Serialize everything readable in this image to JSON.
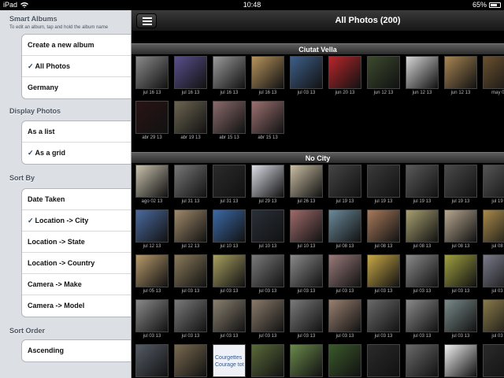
{
  "status": {
    "carrier": "iPad",
    "time": "10:48",
    "battery": "65%"
  },
  "sidebar": {
    "smart_albums": {
      "title": "Smart Albums",
      "subtitle": "To edit an album, tap and hold the album name",
      "items": [
        {
          "label": "Create a new album",
          "checked": false
        },
        {
          "label": "All Photos",
          "checked": true
        },
        {
          "label": "Germany",
          "checked": false
        }
      ]
    },
    "display": {
      "title": "Display Photos",
      "items": [
        {
          "label": "As a list",
          "checked": false
        },
        {
          "label": "As a grid",
          "checked": true
        }
      ]
    },
    "sort_by": {
      "title": "Sort By",
      "items": [
        {
          "label": "Date Taken",
          "checked": false
        },
        {
          "label": "Location -> City",
          "checked": true
        },
        {
          "label": "Location -> State",
          "checked": false
        },
        {
          "label": "Location -> Country",
          "checked": false
        },
        {
          "label": "Camera -> Make",
          "checked": false
        },
        {
          "label": "Camera -> Model",
          "checked": false
        }
      ]
    },
    "sort_order": {
      "title": "Sort Order",
      "items": [
        {
          "label": "Ascending",
          "checked": false
        }
      ]
    }
  },
  "main": {
    "title": "All Photos (200)",
    "sections": [
      {
        "name": "Ciutat Vella",
        "photos": [
          {
            "date": "jul 16 13",
            "color": "#8a8a8a"
          },
          {
            "date": "jul 16 13",
            "color": "#5a4f8c"
          },
          {
            "date": "jul 16 13",
            "color": "#9a9a9a"
          },
          {
            "date": "jul 16 13",
            "color": "#b8945c"
          },
          {
            "date": "jul 03 13",
            "color": "#3d5f8a"
          },
          {
            "date": "jun 20 13",
            "color": "#b8262b"
          },
          {
            "date": "jun 12 13",
            "color": "#3c4a2e"
          },
          {
            "date": "jun 12 13",
            "color": "#d6d6d6"
          },
          {
            "date": "jun 12 13",
            "color": "#a88552"
          },
          {
            "date": "may 07",
            "color": "#6a5030"
          },
          {
            "date": "abr 29 13",
            "color": "#2a1414"
          },
          {
            "date": "abr 19 13",
            "color": "#6b6450"
          },
          {
            "date": "abr 15 13",
            "color": "#8b6a6a"
          },
          {
            "date": "abr 15 13",
            "color": "#9c7070"
          }
        ]
      },
      {
        "name": "No City",
        "photos": [
          {
            "date": "ago 02 13",
            "color": "#c9c2ad"
          },
          {
            "date": "jul 31 13",
            "color": "#777777"
          },
          {
            "date": "jul 31 13",
            "color": "#2b2b2b"
          },
          {
            "date": "jul 29 13",
            "color": "#dcdde6"
          },
          {
            "date": "jul 26 13",
            "color": "#cbbfa3"
          },
          {
            "date": "jul 19 13",
            "color": "#444444"
          },
          {
            "date": "jul 19 13",
            "color": "#3a3a3a"
          },
          {
            "date": "jul 19 13",
            "color": "#5a5a5a"
          },
          {
            "date": "jul 19 13",
            "color": "#4a4a4a"
          },
          {
            "date": "jul 19 1",
            "color": "#555555"
          },
          {
            "date": "jul 12 13",
            "color": "#4a6aa0"
          },
          {
            "date": "jul 12 13",
            "color": "#a08a6a"
          },
          {
            "date": "jul 10 13",
            "color": "#3a6aa8"
          },
          {
            "date": "jul 10 13",
            "color": "#2a2f38"
          },
          {
            "date": "jul 10 13",
            "color": "#a06a6a"
          },
          {
            "date": "jul 08 13",
            "color": "#6a8a9a"
          },
          {
            "date": "jul 08 13",
            "color": "#a87a5a"
          },
          {
            "date": "jul 08 13",
            "color": "#a8a070"
          },
          {
            "date": "jul 08 13",
            "color": "#b8a890"
          },
          {
            "date": "jul 08 1",
            "color": "#a88a4a"
          },
          {
            "date": "jul 05 13",
            "color": "#b89a6a"
          },
          {
            "date": "jul 03 13",
            "color": "#8a7a5a"
          },
          {
            "date": "jul 03 13",
            "color": "#a8a060"
          },
          {
            "date": "jul 03 13",
            "color": "#7a7a7a"
          },
          {
            "date": "jul 03 13",
            "color": "#8a8a8a"
          },
          {
            "date": "jul 03 13",
            "color": "#9a7a7a"
          },
          {
            "date": "jul 03 13",
            "color": "#c9a845"
          },
          {
            "date": "jul 03 13",
            "color": "#8a8a8a"
          },
          {
            "date": "jul 03 13",
            "color": "#a0a040"
          },
          {
            "date": "jul 03 1",
            "color": "#7a7a8a"
          },
          {
            "date": "jul 03 13",
            "color": "#8a8a8a"
          },
          {
            "date": "jul 03 13",
            "color": "#7a7a7a"
          },
          {
            "date": "jul 03 13",
            "color": "#8a8070"
          },
          {
            "date": "jul 03 13",
            "color": "#8a7a6a"
          },
          {
            "date": "jul 03 13",
            "color": "#7a7a7a"
          },
          {
            "date": "jul 03 13",
            "color": "#9a8070"
          },
          {
            "date": "jul 03 13",
            "color": "#6a6a6a"
          },
          {
            "date": "jul 03 13",
            "color": "#8a8a8a"
          },
          {
            "date": "jul 03 13",
            "color": "#7a8a8a"
          },
          {
            "date": "jul 03 1",
            "color": "#8a7a4a"
          },
          {
            "date": "",
            "color": "#555c66"
          },
          {
            "date": "",
            "color": "#7a6a50"
          },
          {
            "date": "",
            "color": "#e8ecf4"
          },
          {
            "date": "",
            "color": "#5a6a3a"
          },
          {
            "date": "",
            "color": "#6a8a4a"
          },
          {
            "date": "",
            "color": "#3a5a2a"
          },
          {
            "date": "",
            "color": "#2a2a2a"
          },
          {
            "date": "",
            "color": "#6a6a6a"
          },
          {
            "date": "",
            "color": "#f0f0f0"
          },
          {
            "date": "",
            "color": "#2a2a2a"
          }
        ]
      }
    ],
    "thumb_texts": {
      "courgettes_line1": "Courgettes",
      "courgettes_line2": "Courage tot"
    }
  }
}
